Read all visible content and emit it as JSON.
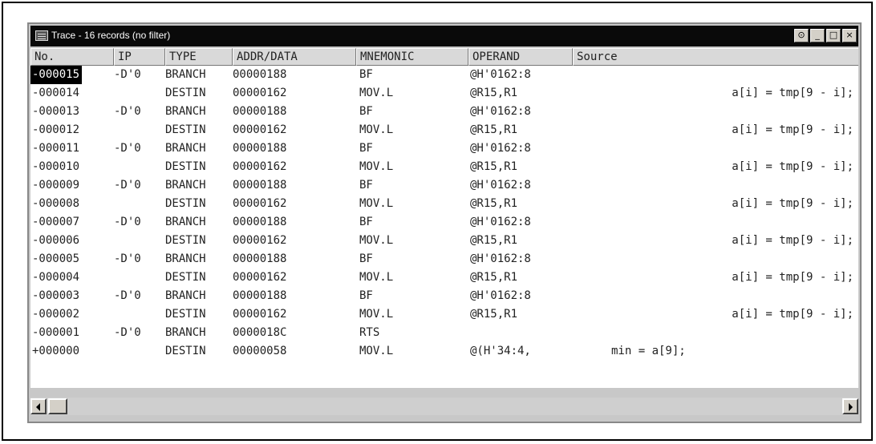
{
  "window": {
    "title": "Trace - 16 records (no filter)",
    "buttons": [
      "⊙",
      "_",
      "□",
      "×"
    ]
  },
  "columns": [
    "No.",
    "IP",
    "TYPE",
    "ADDR/DATA",
    "MNEMONIC",
    "OPERAND",
    "Source"
  ],
  "rows": [
    {
      "no": "-000015",
      "ip": "-D'0",
      "type": "BRANCH",
      "addr": "00000188",
      "mnemonic": "BF",
      "operand": "@H'0162:8",
      "source": ""
    },
    {
      "no": "-000014",
      "ip": "",
      "type": "DESTIN",
      "addr": "00000162",
      "mnemonic": "MOV.L",
      "operand": "@R15,R1",
      "source": "a[i] = tmp[9 - i];"
    },
    {
      "no": "-000013",
      "ip": "-D'0",
      "type": "BRANCH",
      "addr": "00000188",
      "mnemonic": "BF",
      "operand": "@H'0162:8",
      "source": ""
    },
    {
      "no": "-000012",
      "ip": "",
      "type": "DESTIN",
      "addr": "00000162",
      "mnemonic": "MOV.L",
      "operand": "@R15,R1",
      "source": "a[i] = tmp[9 - i];"
    },
    {
      "no": "-000011",
      "ip": "-D'0",
      "type": "BRANCH",
      "addr": "00000188",
      "mnemonic": "BF",
      "operand": "@H'0162:8",
      "source": ""
    },
    {
      "no": "-000010",
      "ip": "",
      "type": "DESTIN",
      "addr": "00000162",
      "mnemonic": "MOV.L",
      "operand": "@R15,R1",
      "source": "a[i] = tmp[9 - i];"
    },
    {
      "no": "-000009",
      "ip": "-D'0",
      "type": "BRANCH",
      "addr": "00000188",
      "mnemonic": "BF",
      "operand": "@H'0162:8",
      "source": ""
    },
    {
      "no": "-000008",
      "ip": "",
      "type": "DESTIN",
      "addr": "00000162",
      "mnemonic": "MOV.L",
      "operand": "@R15,R1",
      "source": "a[i] = tmp[9 - i];"
    },
    {
      "no": "-000007",
      "ip": "-D'0",
      "type": "BRANCH",
      "addr": "00000188",
      "mnemonic": "BF",
      "operand": "@H'0162:8",
      "source": ""
    },
    {
      "no": "-000006",
      "ip": "",
      "type": "DESTIN",
      "addr": "00000162",
      "mnemonic": "MOV.L",
      "operand": "@R15,R1",
      "source": "a[i] = tmp[9 - i];"
    },
    {
      "no": "-000005",
      "ip": "-D'0",
      "type": "BRANCH",
      "addr": "00000188",
      "mnemonic": "BF",
      "operand": "@H'0162:8",
      "source": ""
    },
    {
      "no": "-000004",
      "ip": "",
      "type": "DESTIN",
      "addr": "00000162",
      "mnemonic": "MOV.L",
      "operand": "@R15,R1",
      "source": "a[i] = tmp[9 - i];"
    },
    {
      "no": "-000003",
      "ip": "-D'0",
      "type": "BRANCH",
      "addr": "00000188",
      "mnemonic": "BF",
      "operand": "@H'0162:8",
      "source": ""
    },
    {
      "no": "-000002",
      "ip": "",
      "type": "DESTIN",
      "addr": "00000162",
      "mnemonic": "MOV.L",
      "operand": "@R15,R1",
      "source": "a[i] = tmp[9 - i];"
    },
    {
      "no": "-000001",
      "ip": "-D'0",
      "type": "BRANCH",
      "addr": "0000018C",
      "mnemonic": "RTS",
      "operand": "",
      "source": ""
    },
    {
      "no": "+000000",
      "ip": "",
      "type": "DESTIN",
      "addr": "00000058",
      "mnemonic": "MOV.L",
      "operand": "@(H'34:4,",
      "source": "min = a[9];"
    }
  ],
  "selected_row": 0,
  "colors": {
    "titlebar": "#0a0a0a",
    "selection": "#000000",
    "header": "#d9d9d9"
  }
}
